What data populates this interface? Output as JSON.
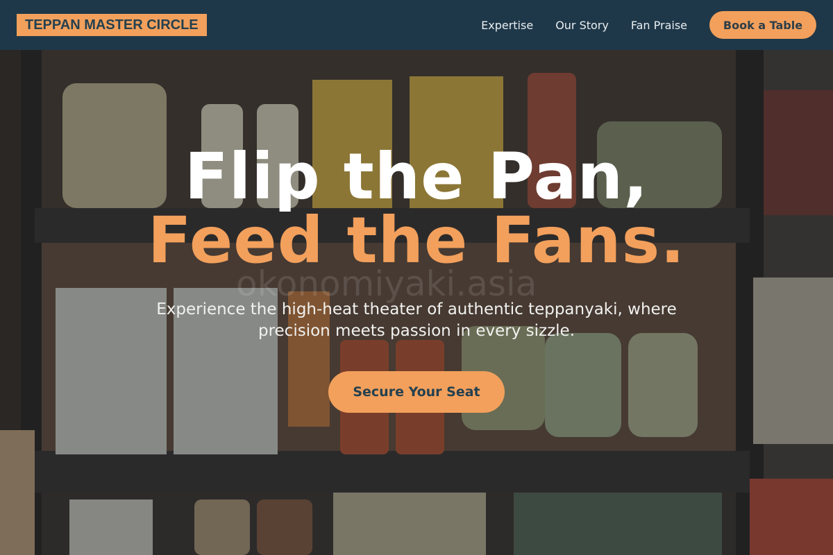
{
  "brand": {
    "logo_text": "TEPPAN MASTER CIRCLE"
  },
  "nav": {
    "links": [
      "Expertise",
      "Our Story",
      "Fan Praise"
    ],
    "cta_label": "Book a Table"
  },
  "hero": {
    "headline_line1": "Flip the Pan,",
    "headline_line2": "Feed the Fans.",
    "subtitle": "Experience the high-heat theater of authentic teppanyaki, where precision meets passion in every sizzle.",
    "cta_label": "Secure Your Seat",
    "watermark": "okonomiyaki.asia"
  },
  "colors": {
    "accent": "#f2a05c",
    "navbar": "#1e3a4c",
    "text_dark": "#24404f"
  }
}
